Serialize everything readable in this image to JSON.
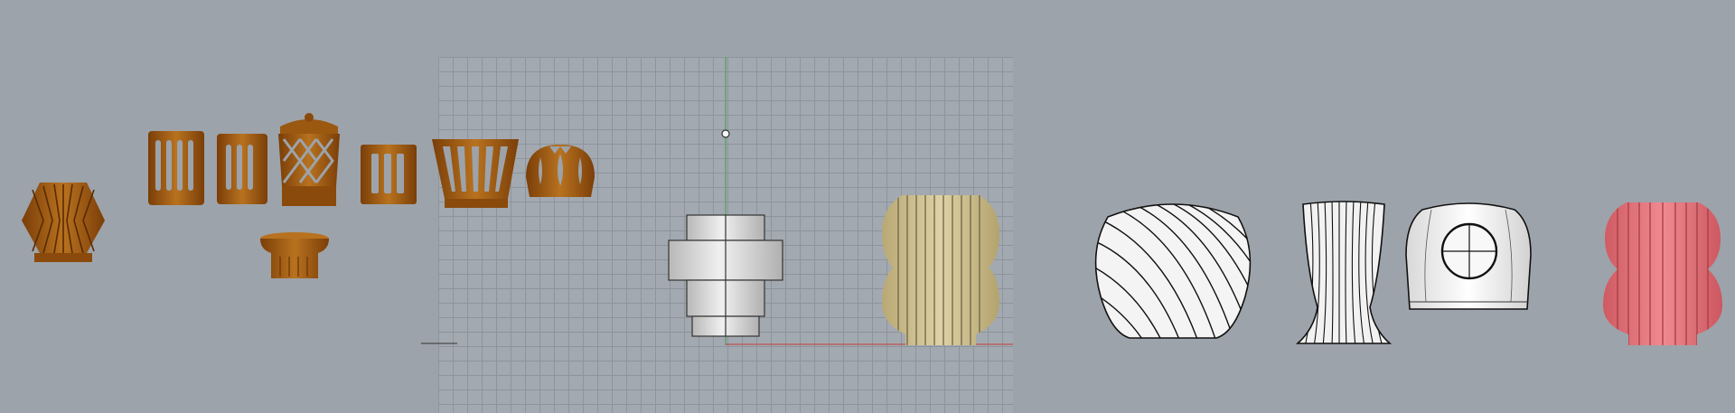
{
  "viewport": {
    "background_color": "#9da3aa",
    "grid_color": "#8e949b",
    "axis_x_color": "#c43a3a",
    "axis_y_color": "#3aa050"
  },
  "colors": {
    "copper_dark": "#8a4a0c",
    "copper_light": "#b06a1c",
    "gold": "#cbbd8b",
    "gray_solid": "#e2e2e2",
    "pink": "#e46b72"
  },
  "objects": [
    {
      "name": "copper-lantern-faceted"
    },
    {
      "name": "copper-cylinder-slots-large"
    },
    {
      "name": "copper-cylinder-slots-small"
    },
    {
      "name": "copper-lattice-cap"
    },
    {
      "name": "copper-box-slots"
    },
    {
      "name": "copper-tapered-slots"
    },
    {
      "name": "copper-sphere-cutout"
    },
    {
      "name": "copper-flared-base"
    },
    {
      "name": "gray-stacked-cylinders"
    },
    {
      "name": "gold-ribbed-double-bulb"
    },
    {
      "name": "wireframe-twisted-vase"
    },
    {
      "name": "wireframe-tall-flared-vase"
    },
    {
      "name": "white-rounded-box-porthole"
    },
    {
      "name": "pink-ribbed-double-bulb"
    }
  ]
}
